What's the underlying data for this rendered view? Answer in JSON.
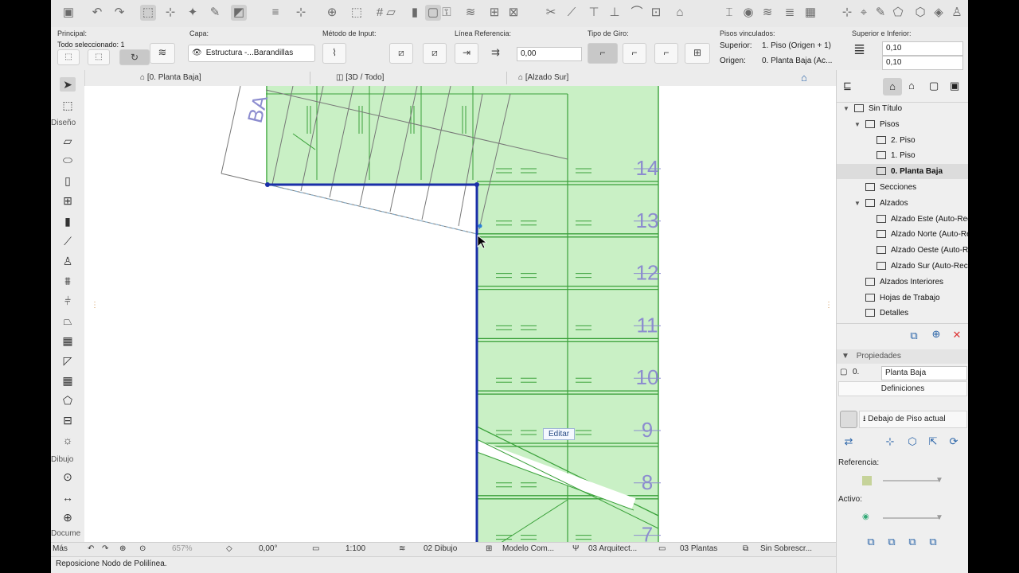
{
  "toolbar": {
    "icons": [
      "save-icon",
      "undo-icon",
      "redo-icon",
      "trace-icon",
      "trace-ref-icon",
      "magic-wand-icon",
      "pick-up-icon",
      "marquee-arrow-icon",
      "gravity-icon",
      "snap-guides-icon",
      "snap-points-icon",
      "suspend-groups-icon",
      "grid-icon",
      "ruler-icon",
      "cursor-snap-icon",
      "layer-icon",
      "lock-icon",
      "trim-icon",
      "intersect-icon",
      "adjust-icon",
      "cut-icon",
      "split-icon",
      "offset-icon",
      "explode-icon",
      "fillet-icon",
      "resize-icon",
      "stretch-icon",
      "rotate-icon",
      "mirror-icon",
      "drag-icon",
      "pen-icon",
      "shape-icon",
      "fill-icon",
      "3d-icon",
      "3d-view-icon",
      "floor-icon",
      "wall-icon",
      "camera-icon",
      "tools-icon"
    ]
  },
  "infobox": {
    "principal_label": "Principal:",
    "principal_value": "Todo seleccionado: 1",
    "capa_label": "Capa:",
    "capa_value": "Estructura -...Barandillas",
    "metodo_label": "Método de Input:",
    "linea_label": "Línea Referencia:",
    "linea_value": "0,00",
    "giro_label": "Tipo de Giro:",
    "pisos_label": "Pisos vinculados:",
    "superior_label": "Superior:",
    "superior_value": "1. Piso (Origen + 1)",
    "origen_label": "Origen:",
    "origen_value": "0. Planta Baja (Ac...",
    "sup_inf_label": "Superior e Inferior:",
    "sup_value": "0,10",
    "inf_value": "0,10"
  },
  "tabs": [
    {
      "label": "[0. Planta Baja]"
    },
    {
      "label": "[3D / Todo]"
    },
    {
      "label": "[Alzado Sur]"
    }
  ],
  "toolbox": {
    "group_design": "Diseño",
    "group_drawing": "Dibujo",
    "group_document": "Docume",
    "more": "Más"
  },
  "canvas": {
    "step_numbers": [
      "14",
      "13",
      "12",
      "11",
      "10",
      "9",
      "8",
      "7"
    ],
    "stair_label": "BA",
    "tooltip": "Editar",
    "line_color": "#1a2fa8",
    "stair_fill": "#c9f0c5",
    "stair_line": "#3aa13a"
  },
  "statusbar": {
    "zoom": "657%",
    "angle": "0,00°",
    "scale": "1:100",
    "layer_combo": "02 Dibujo",
    "model_view": "Modelo Com...",
    "pen_set": "03 Arquitect...",
    "dimension": "03 Plantas",
    "override": "Sin Sobrescr..."
  },
  "message": "Reposicione Nodo de Polilínea.",
  "navigator": {
    "tree": [
      {
        "label": "Sin Título",
        "level": 0,
        "icon": "house-icon",
        "expanded": true
      },
      {
        "label": "Pisos",
        "level": 1,
        "icon": "floors-icon",
        "expanded": true
      },
      {
        "label": "2. Piso",
        "level": 2,
        "icon": "floor-icon"
      },
      {
        "label": "1. Piso",
        "level": 2,
        "icon": "floor-icon"
      },
      {
        "label": "0. Planta Baja",
        "level": 2,
        "icon": "floor-icon",
        "selected": true
      },
      {
        "label": "Secciones",
        "level": 1,
        "icon": "section-icon"
      },
      {
        "label": "Alzados",
        "level": 1,
        "icon": "elevation-icon",
        "expanded": true
      },
      {
        "label": "Alzado Este (Auto-Rec",
        "level": 2,
        "icon": "elevation-icon"
      },
      {
        "label": "Alzado Norte (Auto-Re",
        "level": 2,
        "icon": "elevation-icon"
      },
      {
        "label": "Alzado Oeste (Auto-R",
        "level": 2,
        "icon": "elevation-icon"
      },
      {
        "label": "Alzado Sur (Auto-Rec",
        "level": 2,
        "icon": "elevation-icon"
      },
      {
        "label": "Alzados Interiores",
        "level": 1,
        "icon": "interior-elevation-icon"
      },
      {
        "label": "Hojas de Trabajo",
        "level": 1,
        "icon": "worksheet-icon"
      },
      {
        "label": "Detalles",
        "level": 1,
        "icon": "detail-icon"
      }
    ],
    "properties_header": "Propiedades",
    "prop_number": "0.",
    "prop_name": "Planta Baja",
    "definitions": "Definiciones",
    "below_floor": "Debajo de Piso actual",
    "referencia": "Referencia:",
    "activo": "Activo:"
  }
}
